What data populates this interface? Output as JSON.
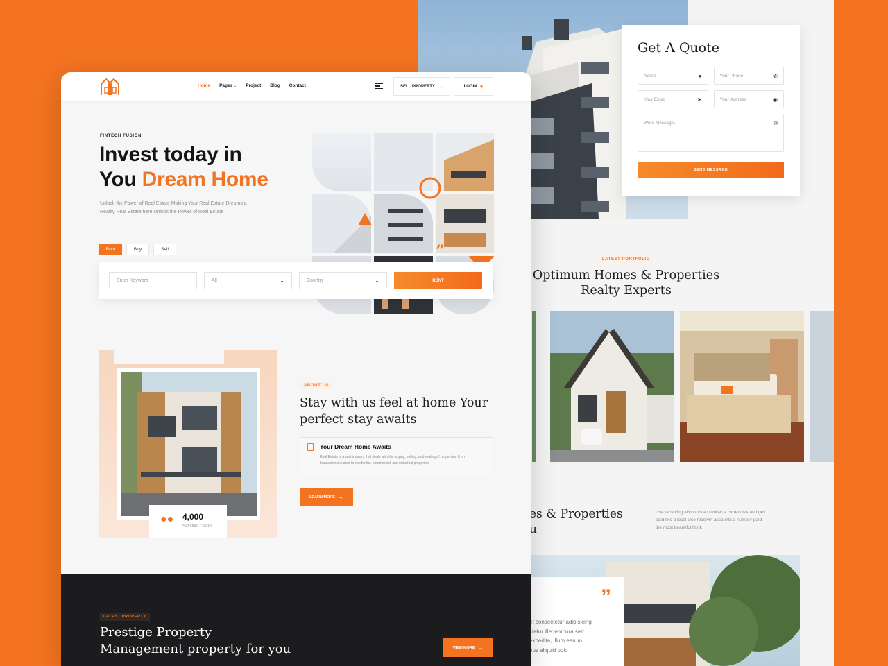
{
  "colors": {
    "accent": "#f37321",
    "background": "#f37321",
    "dark_section": "#1c1b1d"
  },
  "nav": {
    "logo_icon": "house-logo-icon",
    "items": [
      {
        "label": "Home",
        "active": true
      },
      {
        "label": "Pages"
      },
      {
        "label": "Project"
      },
      {
        "label": "Blog"
      },
      {
        "label": "Contact"
      }
    ],
    "sell_button": "SELL PROPERTY",
    "login_button": "LOGIN"
  },
  "hero": {
    "kicker": "FINTECH FUSION",
    "headline_line1": "Invest today in",
    "headline_line2_a": "You ",
    "headline_line2_b": "Dream Home",
    "subtext": "Unlock the Power of Real Estate Making Your Real Estate Dreams a Reality Real Estate here Unlock the Power of Real Estate"
  },
  "tabs": [
    {
      "label": "Rent",
      "active": true
    },
    {
      "label": "Buy"
    },
    {
      "label": "Sell"
    }
  ],
  "search": {
    "keyword_placeholder": "Enter Keyword",
    "type_value": "All",
    "country_value": "Country",
    "submit": "RENT"
  },
  "about": {
    "tag": "ABOUT US",
    "title_line1": "Stay with us feel at home Your",
    "title_line2": "perfect stay awaits",
    "feature_title": "Your Dream Home Awaits",
    "feature_desc_line1": "Real Estate is a vast industry that deals with the buying, selling, and renting of properties. It en",
    "feature_desc_line2": "transactions related to residential, commercial, and industrial properties",
    "learn_more": "LEARN MORE",
    "stat_value": "4,000",
    "stat_label": "Satisfied Clients"
  },
  "latest": {
    "tag": "LATEST PROPERTY",
    "title_line1": "Prestige Property",
    "title_line2": "Management property for you",
    "view_more": "VIEW MORE"
  },
  "quote": {
    "title": "Get A Quote",
    "name": "Name",
    "phone": "Your Phone",
    "email": "Your Email",
    "address": "Your Address",
    "message": "Write Message..",
    "submit": "SEND MESSAGE"
  },
  "portfolio": {
    "tag": "LATEST PORTFOLIO",
    "title_line1": "Optimum Homes & Properties",
    "title_line2": "Realty Experts"
  },
  "bottom": {
    "title_line1": "es & Properties",
    "title_line2": "u",
    "paragraph": "Use receiving accounts a number a currencies and get paid like a local Use receivin accounts a number paid the most beautiful think",
    "testimonial_lines": [
      "et consectetur adipisicing",
      "ctetur ille tempora sed",
      "expedita, illum earum",
      "bus aliquid odio"
    ]
  }
}
